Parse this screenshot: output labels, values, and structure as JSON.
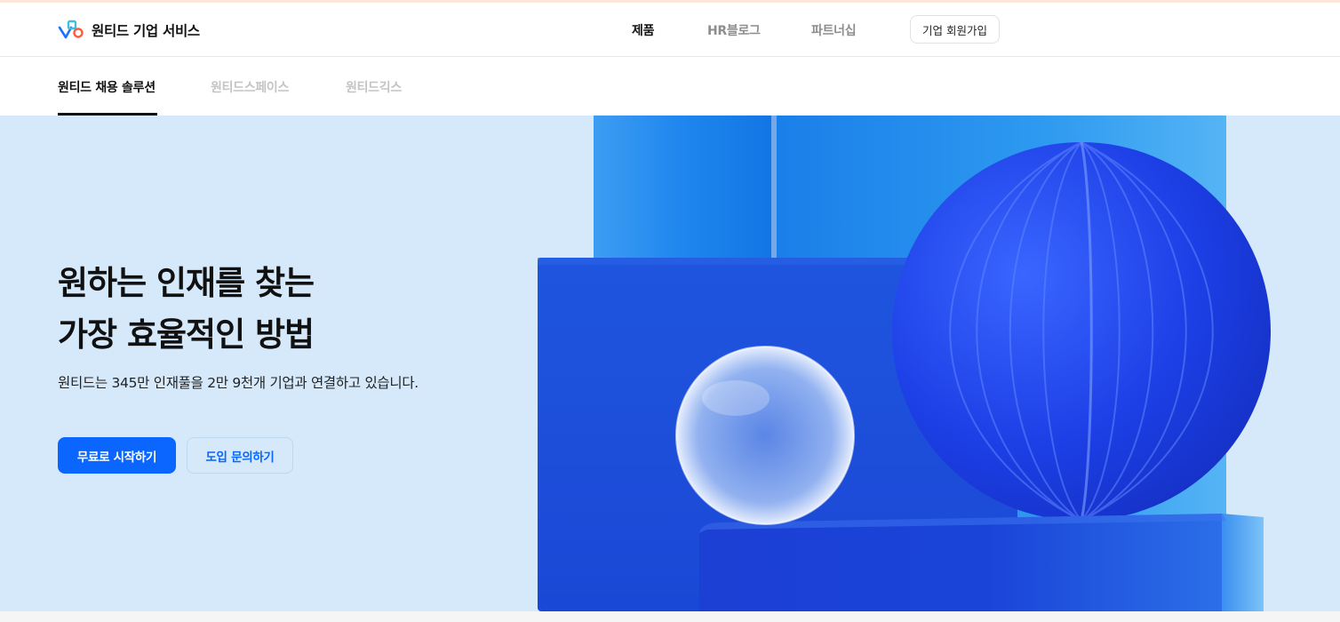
{
  "brand": {
    "name": "원티드 기업 서비스"
  },
  "nav": {
    "items": [
      {
        "label": "제품",
        "active": true
      },
      {
        "label": "HR블로그",
        "active": false
      },
      {
        "label": "파트너십",
        "active": false
      }
    ],
    "signup_label": "기업 회원가입"
  },
  "subnav": {
    "items": [
      {
        "label": "원티드 채용 솔루션",
        "active": true
      },
      {
        "label": "원티드스페이스",
        "active": false
      },
      {
        "label": "원티드긱스",
        "active": false
      }
    ]
  },
  "hero": {
    "title_line1": "원하는 인재를 찾는",
    "title_line2": "가장 효율적인 방법",
    "subtitle": "원티드는 345만 인재풀을 2만 9천개 기업과 연결하고 있습니다.",
    "primary_button": "무료로 시작하기",
    "secondary_button": "도입 문의하기"
  },
  "colors": {
    "accent": "#0a66ff",
    "hero_background": "#d5e9fb",
    "text": "#111111"
  }
}
